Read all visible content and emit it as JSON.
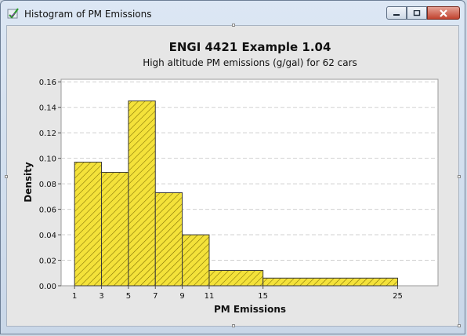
{
  "window": {
    "title": "Histogram of PM Emissions"
  },
  "chart_data": {
    "type": "histogram",
    "title": "ENGI 4421 Example 1.04",
    "subtitle": "High altitude PM emissions (g/gal) for 62 cars",
    "xlabel": "PM Emissions",
    "ylabel": "Density",
    "bins": [
      {
        "from": 1,
        "to": 3,
        "density": 0.097
      },
      {
        "from": 3,
        "to": 5,
        "density": 0.089
      },
      {
        "from": 5,
        "to": 7,
        "density": 0.145
      },
      {
        "from": 7,
        "to": 9,
        "density": 0.073
      },
      {
        "from": 9,
        "to": 11,
        "density": 0.04
      },
      {
        "from": 11,
        "to": 15,
        "density": 0.012
      },
      {
        "from": 15,
        "to": 25,
        "density": 0.006
      }
    ],
    "xticks": [
      1,
      3,
      5,
      7,
      9,
      11,
      15,
      25
    ],
    "yticks": [
      "0.00",
      "0.02",
      "0.04",
      "0.06",
      "0.08",
      "0.10",
      "0.12",
      "0.14",
      "0.16"
    ],
    "xlim": [
      0,
      28
    ],
    "ylim": [
      0,
      0.162
    ],
    "grid": "horizontal dashed",
    "colors": {
      "fill": "#f4e23a",
      "hatch": "#7a6a00",
      "edge": "#3a3a3a"
    }
  }
}
